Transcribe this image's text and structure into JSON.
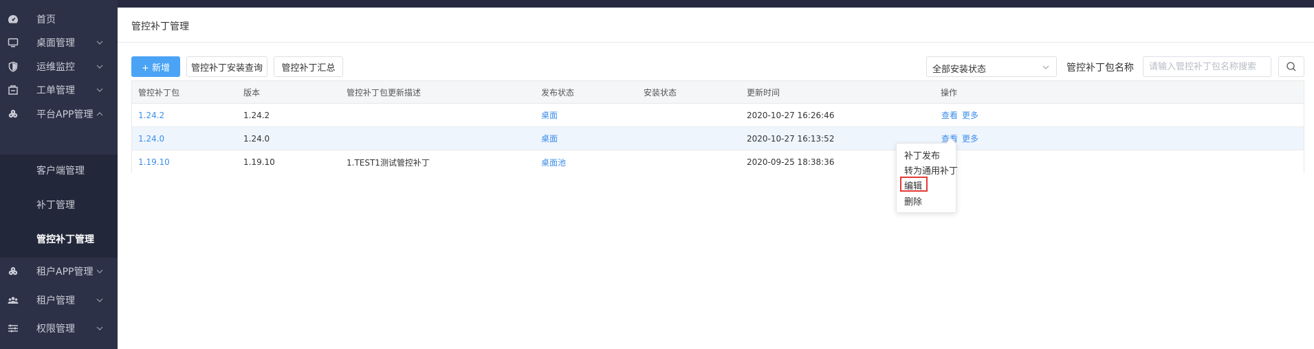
{
  "sidebar": {
    "items": [
      {
        "label": "首页",
        "icon": "dashboard-icon"
      },
      {
        "label": "桌面管理",
        "icon": "monitor-icon"
      },
      {
        "label": "运维监控",
        "icon": "shield-icon"
      },
      {
        "label": "工单管理",
        "icon": "ticket-icon"
      },
      {
        "label": "平台APP管理",
        "icon": "apps-icon"
      },
      {
        "label": "租户APP管理",
        "icon": "apps-icon"
      },
      {
        "label": "租户管理",
        "icon": "users-icon"
      },
      {
        "label": "权限管理",
        "icon": "sliders-icon"
      }
    ],
    "sub_items": [
      {
        "label": "客户端管理"
      },
      {
        "label": "补丁管理"
      },
      {
        "label": "管控补丁管理"
      }
    ]
  },
  "page": {
    "title": "管控补丁管理"
  },
  "toolbar": {
    "add_label": "+ 新增",
    "install_query_label": "管控补丁安装查询",
    "summary_label": "管控补丁汇总",
    "install_status_select": "全部安装状态",
    "search_label": "管控补丁包名称",
    "search_placeholder": "请输入管控补丁包名称搜索"
  },
  "table": {
    "headers": [
      "管控补丁包",
      "版本",
      "管控补丁包更新描述",
      "发布状态",
      "安装状态",
      "更新时间",
      "操作"
    ],
    "rows": [
      {
        "package": "1.24.2",
        "version": "1.24.2",
        "description": "",
        "publish_status": "桌面",
        "install_status": "",
        "updated": "2020-10-27 16:26:46",
        "view": "查看",
        "more": "更多"
      },
      {
        "package": "1.24.0",
        "version": "1.24.0",
        "description": "",
        "publish_status": "桌面",
        "install_status": "",
        "updated": "2020-10-27 16:13:52",
        "view": "查看",
        "more": "更多"
      },
      {
        "package": "1.19.10",
        "version": "1.19.10",
        "description": "1.TEST1测试管控补丁",
        "publish_status": "桌面池",
        "install_status": "",
        "updated": "2020-09-25 18:38:36"
      }
    ]
  },
  "dropdown": {
    "items": [
      "补丁发布",
      "转为通用补丁",
      "编辑",
      "删除"
    ]
  },
  "colors": {
    "sidebar_bg": "#2d3147",
    "primary": "#4aa3f5",
    "link": "#3d8eea",
    "highlight_border": "#e53935"
  }
}
